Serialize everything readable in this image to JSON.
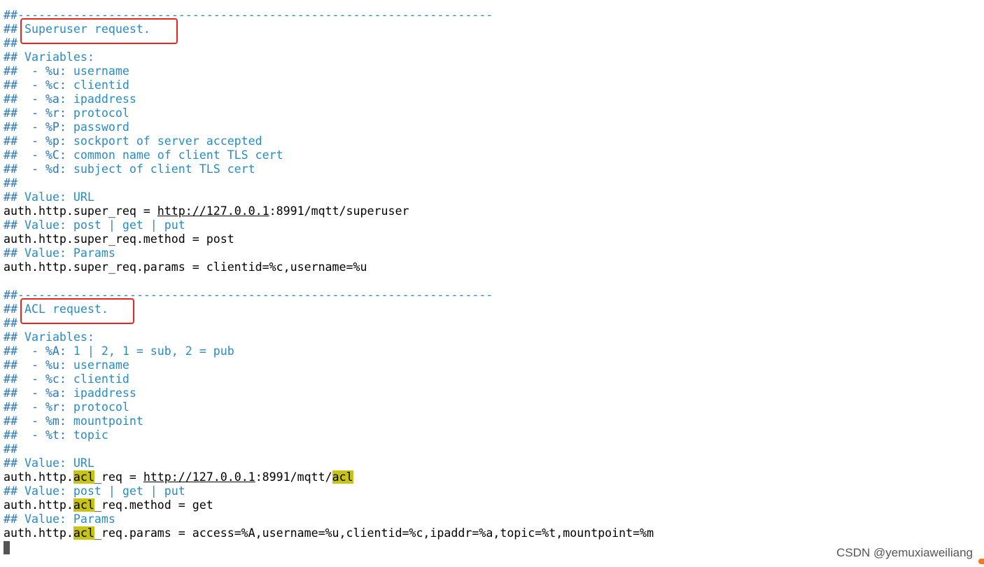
{
  "terminal": {
    "lines": [
      [
        {
          "t": "##",
          "s": "hash"
        },
        {
          "t": "--------------------------------------------------------------------",
          "s": "dash"
        }
      ],
      [
        {
          "t": "## ",
          "s": "hash"
        },
        {
          "t": "Superuser request.",
          "s": "comment"
        }
      ],
      [
        {
          "t": "##",
          "s": "hash"
        }
      ],
      [
        {
          "t": "## ",
          "s": "hash"
        },
        {
          "t": "Variables:",
          "s": "comment"
        }
      ],
      [
        {
          "t": "##  - %u: ",
          "s": "hash"
        },
        {
          "t": "username",
          "s": "comment"
        }
      ],
      [
        {
          "t": "##  - %c: ",
          "s": "hash"
        },
        {
          "t": "clientid",
          "s": "comment"
        }
      ],
      [
        {
          "t": "##  - %a: ",
          "s": "hash"
        },
        {
          "t": "ipaddress",
          "s": "comment"
        }
      ],
      [
        {
          "t": "##  - %r: ",
          "s": "hash"
        },
        {
          "t": "protocol",
          "s": "comment"
        }
      ],
      [
        {
          "t": "##  - %P: ",
          "s": "hash"
        },
        {
          "t": "password",
          "s": "comment"
        }
      ],
      [
        {
          "t": "##  - %p: ",
          "s": "hash"
        },
        {
          "t": "sockport of server accepted",
          "s": "comment"
        }
      ],
      [
        {
          "t": "##  - %C: ",
          "s": "hash"
        },
        {
          "t": "common name of client TLS cert",
          "s": "comment"
        }
      ],
      [
        {
          "t": "##  - %d: ",
          "s": "hash"
        },
        {
          "t": "subject of client TLS cert",
          "s": "comment"
        }
      ],
      [
        {
          "t": "##",
          "s": "hash"
        }
      ],
      [
        {
          "t": "## ",
          "s": "hash"
        },
        {
          "t": "Value: URL",
          "s": "comment"
        }
      ],
      [
        {
          "t": "auth.http.super_req = ",
          "s": "code"
        },
        {
          "t": "http://127.0.0.1",
          "s": "url"
        },
        {
          "t": ":8991/mqtt/superuser",
          "s": "code"
        }
      ],
      [
        {
          "t": "## ",
          "s": "hash"
        },
        {
          "t": "Value: post | get | put",
          "s": "comment"
        }
      ],
      [
        {
          "t": "auth.http.super_req.method = post",
          "s": "code"
        }
      ],
      [
        {
          "t": "## ",
          "s": "hash"
        },
        {
          "t": "Value: Params",
          "s": "comment"
        }
      ],
      [
        {
          "t": "auth.http.super_req.params = clientid=%c,username=%u",
          "s": "code"
        }
      ],
      [],
      [
        {
          "t": "##",
          "s": "hash"
        },
        {
          "t": "--------------------------------------------------------------------",
          "s": "dash"
        }
      ],
      [
        {
          "t": "## ",
          "s": "hash"
        },
        {
          "t": "ACL request.",
          "s": "comment"
        }
      ],
      [
        {
          "t": "##",
          "s": "hash"
        }
      ],
      [
        {
          "t": "## ",
          "s": "hash"
        },
        {
          "t": "Variables:",
          "s": "comment"
        }
      ],
      [
        {
          "t": "##  - %A: ",
          "s": "hash"
        },
        {
          "t": "1 | 2, 1 = sub, 2 = pub",
          "s": "comment"
        }
      ],
      [
        {
          "t": "##  - %u: ",
          "s": "hash"
        },
        {
          "t": "username",
          "s": "comment"
        }
      ],
      [
        {
          "t": "##  - %c: ",
          "s": "hash"
        },
        {
          "t": "clientid",
          "s": "comment"
        }
      ],
      [
        {
          "t": "##  - %a: ",
          "s": "hash"
        },
        {
          "t": "ipaddress",
          "s": "comment"
        }
      ],
      [
        {
          "t": "##  - %r: ",
          "s": "hash"
        },
        {
          "t": "protocol",
          "s": "comment"
        }
      ],
      [
        {
          "t": "##  - %m: ",
          "s": "hash"
        },
        {
          "t": "mountpoint",
          "s": "comment"
        }
      ],
      [
        {
          "t": "##  - %t: ",
          "s": "hash"
        },
        {
          "t": "topic",
          "s": "comment"
        }
      ],
      [
        {
          "t": "##",
          "s": "hash"
        }
      ],
      [
        {
          "t": "## ",
          "s": "hash"
        },
        {
          "t": "Value: URL",
          "s": "comment"
        }
      ],
      [
        {
          "t": "auth.http.",
          "s": "code"
        },
        {
          "t": "acl",
          "s": "hl"
        },
        {
          "t": "_req = ",
          "s": "code"
        },
        {
          "t": "http://127.0.0.1",
          "s": "url"
        },
        {
          "t": ":8991/mqtt/",
          "s": "code"
        },
        {
          "t": "acl",
          "s": "hl"
        }
      ],
      [
        {
          "t": "## ",
          "s": "hash"
        },
        {
          "t": "Value: post | get | put",
          "s": "comment"
        }
      ],
      [
        {
          "t": "auth.http.",
          "s": "code"
        },
        {
          "t": "acl",
          "s": "hl"
        },
        {
          "t": "_req.method = get",
          "s": "code"
        }
      ],
      [
        {
          "t": "## ",
          "s": "hash"
        },
        {
          "t": "Value: Params",
          "s": "comment"
        }
      ],
      [
        {
          "t": "auth.http.",
          "s": "code"
        },
        {
          "t": "acl",
          "s": "hl"
        },
        {
          "t": "_req.params = access=%A,username=%u,clientid=%c,ipaddr=%a,topic=%t,mountpoint=%m",
          "s": "code"
        }
      ],
      [
        {
          "t": "",
          "s": "cursor"
        }
      ]
    ]
  },
  "watermark": "CSDN @yemuxiaweiliang",
  "colors": {
    "comment": "#2a8bc1",
    "hash": "#2b78b7",
    "highlight": "#c8c416",
    "annotation_box": "#e8261f"
  }
}
